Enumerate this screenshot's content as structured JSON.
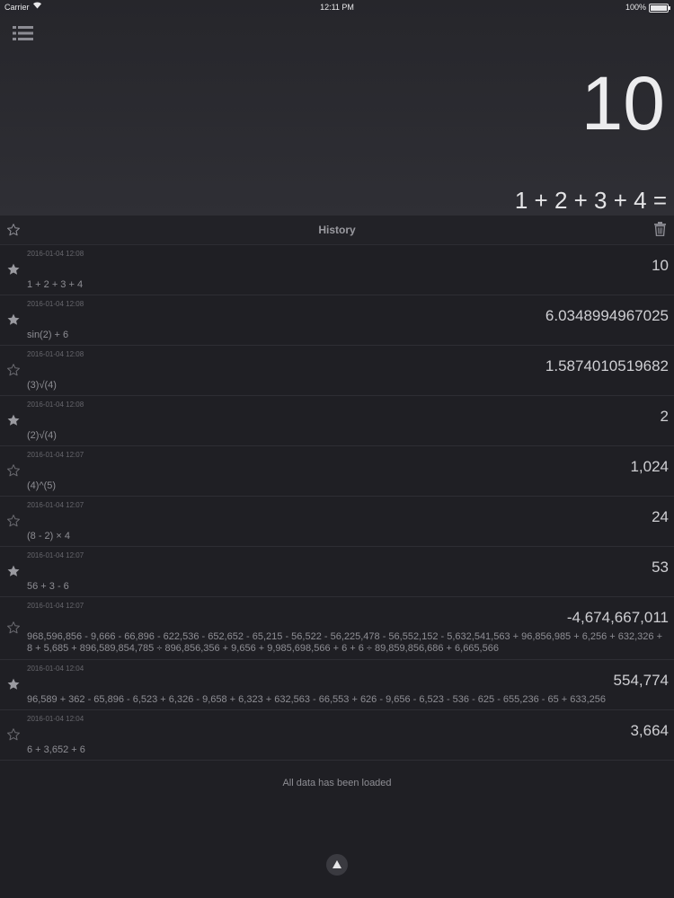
{
  "status": {
    "carrier": "Carrier",
    "time": "12:11 PM",
    "battery": "100%"
  },
  "display": {
    "result": "10",
    "expression": "1 + 2 + 3 + 4 ="
  },
  "history": {
    "title": "History",
    "items": [
      {
        "timestamp": "2016-01-04 12:08",
        "value": "10",
        "expression": "1 + 2 + 3 + 4",
        "starred": true
      },
      {
        "timestamp": "2016-01-04 12:08",
        "value": "6.0348994967025",
        "expression": "sin(2) + 6",
        "starred": true
      },
      {
        "timestamp": "2016-01-04 12:08",
        "value": "1.5874010519682",
        "expression": "(3)√(4)",
        "starred": false
      },
      {
        "timestamp": "2016-01-04 12:08",
        "value": "2",
        "expression": "(2)√(4)",
        "starred": true
      },
      {
        "timestamp": "2016-01-04 12:07",
        "value": "1,024",
        "expression": "(4)^(5)",
        "starred": false
      },
      {
        "timestamp": "2016-01-04 12:07",
        "value": "24",
        "expression": "(8 - 2) × 4",
        "starred": false
      },
      {
        "timestamp": "2016-01-04 12:07",
        "value": "53",
        "expression": "56 + 3 - 6",
        "starred": true
      },
      {
        "timestamp": "2016-01-04 12:07",
        "value": "-4,674,667,011",
        "expression": "968,596,856 - 9,666 - 66,896 - 622,536 - 652,652 - 65,215 - 56,522 - 56,225,478 - 56,552,152 - 5,632,541,563 + 96,856,985 + 6,256 + 632,326 + 8 + 5,685 + 896,589,854,785 ÷ 896,856,356 + 9,656 + 9,985,698,566 + 6 + 6 ÷ 89,859,856,686 + 6,665,566",
        "starred": false
      },
      {
        "timestamp": "2016-01-04 12:04",
        "value": "554,774",
        "expression": "96,589 + 362 - 65,896 - 6,523 + 6,326 - 9,658 + 6,323 + 632,563 - 66,553 + 626 - 9,656 - 6,523 - 536 - 625 - 655,236 - 65 + 633,256",
        "starred": true
      },
      {
        "timestamp": "2016-01-04 12:04",
        "value": "3,664",
        "expression": "6 + 3,652 + 6",
        "starred": false
      }
    ],
    "footer": "All data has been loaded"
  },
  "icons": {
    "menu": "list-menu-icon",
    "favorites": "star-outline-icon",
    "trash": "trash-icon",
    "scroll_top": "arrow-up-icon"
  },
  "colors": {
    "background": "#1f1f24",
    "display_bg": "#2f2f35",
    "text": "#d6d6da",
    "muted": "#8e8e94"
  }
}
